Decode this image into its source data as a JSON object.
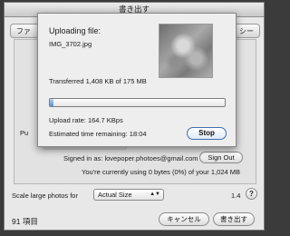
{
  "window": {
    "title": "書き出す"
  },
  "tabs": {
    "left_partial": "ファ",
    "right_partial": "シー"
  },
  "upload_sheet": {
    "heading": "Uploading file:",
    "filename": "IMG_3702.jpg",
    "transferred": "Transferred 1,408 KB of 175 MB",
    "progress": 0.01,
    "upload_rate": "Upload rate: 164.7 KBps",
    "time_remaining": "Estimated time remaining: 18:04",
    "stop_label": "Stop"
  },
  "account": {
    "signed_in": "Signed in as: lovepoper.photoes@gmail.com",
    "sign_out_label": "Sign Out",
    "usage": "You're currently using 0 bytes (0%) of your 1,024 MB"
  },
  "scale": {
    "label": "Scale large photos for",
    "selected": "Actual Size"
  },
  "version": "1.4",
  "help_label": "?",
  "footer": {
    "item_count": "91 項目",
    "cancel_label": "キャンセル",
    "export_label": "書き出す"
  },
  "side_partial": "Pu"
}
